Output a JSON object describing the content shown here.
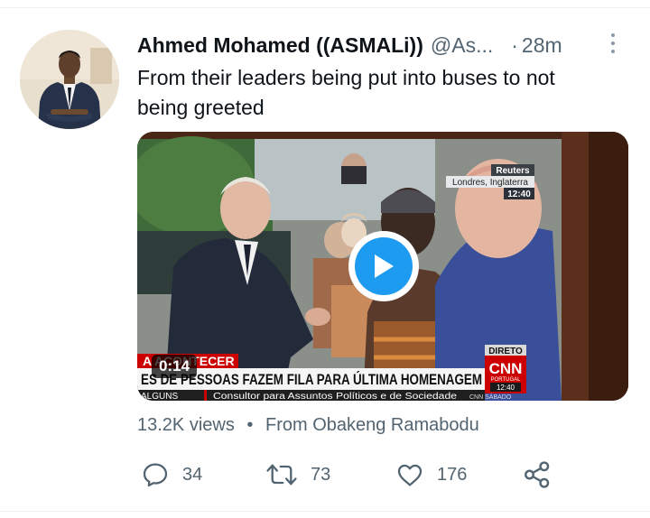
{
  "tweet": {
    "display_name": "Ahmed Mohamed ((ASMALi))",
    "handle": "@As...",
    "separator": "·",
    "time": "28m",
    "text": "From their leaders being put into buses to not being greeted",
    "avatar_icon": "profile-photo"
  },
  "media": {
    "type": "video",
    "duration": "0:14",
    "play_icon": "play-icon",
    "video_frame": {
      "reuters": "Reuters",
      "location": "Londres, Inglaterra",
      "clock": "12:40",
      "banner_tag": "A ACONTECER",
      "headline": "ES DE PESSOAS FAZEM FILA PARA ÚLTIMA HOMENAGEM",
      "ticker_left": "ALGUNS",
      "ticker_right": "Consultor para Assuntos Políticos e de Sociedade",
      "live_label": "DIRETO",
      "network": "CNN",
      "network_sub": "PORTUGAL",
      "network_time": "12:40",
      "ticker_channel": "CNN SÁBADO"
    }
  },
  "meta": {
    "views": "13.2K views",
    "bullet": "•",
    "from_label": "From Obakeng Ramabodu"
  },
  "actions": {
    "reply_count": "34",
    "retweet_count": "73",
    "like_count": "176"
  },
  "colors": {
    "accent": "#1d9bf0",
    "secondary_text": "#536471",
    "primary_text": "#0f1419",
    "divider": "#eff3f4"
  }
}
